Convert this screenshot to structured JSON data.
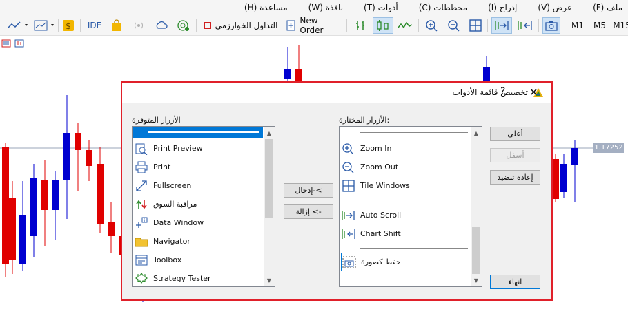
{
  "menu": {
    "items": [
      "ملف (F)",
      "عرض (V)",
      "إدراج (I)",
      "مخططات (C)",
      "أدوات (T)",
      "نافذة (W)",
      "مساعدة (H)"
    ]
  },
  "toolbar": {
    "ide_label": "IDE",
    "algo_trading_label": "التداول الخوارزمي",
    "new_order_label": "New Order",
    "timeframes": [
      "M1",
      "M5",
      "M15"
    ]
  },
  "chart": {
    "price_label": "1.17252",
    "colors": {
      "bull": "#0000d0",
      "bear": "#e00000",
      "price_line": "#9aa5b8"
    }
  },
  "dialog": {
    "title": "تخصيص قائمة الأدوات",
    "help": "?",
    "close": "✕",
    "available_label": "الأزرار المتوفرة",
    "selected_label": "الأزرار المختارة:",
    "available_items": [
      {
        "label": "",
        "icon": "separator"
      },
      {
        "label": "Print Preview",
        "icon": "print-preview-icon"
      },
      {
        "label": "Print",
        "icon": "printer-icon"
      },
      {
        "label": "Fullscreen",
        "icon": "fullscreen-icon"
      },
      {
        "label": "مراقبة السوق",
        "icon": "market-watch-icon"
      },
      {
        "label": "Data Window",
        "icon": "data-window-icon"
      },
      {
        "label": "Navigator",
        "icon": "navigator-folder-icon"
      },
      {
        "label": "Toolbox",
        "icon": "toolbox-icon"
      },
      {
        "label": "Strategy Tester",
        "icon": "strategy-tester-icon"
      }
    ],
    "selected_items": [
      {
        "label": "",
        "icon": "separator"
      },
      {
        "label": "Zoom In",
        "icon": "zoom-in-icon"
      },
      {
        "label": "Zoom Out",
        "icon": "zoom-out-icon"
      },
      {
        "label": "Tile Windows",
        "icon": "tile-windows-icon"
      },
      {
        "label": "",
        "icon": "separator"
      },
      {
        "label": "Auto Scroll",
        "icon": "auto-scroll-icon"
      },
      {
        "label": "Chart Shift",
        "icon": "chart-shift-icon"
      },
      {
        "label": "",
        "icon": "separator"
      },
      {
        "label": "حفظ كصورة",
        "icon": "screenshot-icon"
      }
    ],
    "insert_button": "إدخال-<",
    "remove_button": "إزالة <-",
    "up_button": "أعلى",
    "down_button": "أسفل",
    "reset_button": "إعادة تنضيد",
    "finish_button": "انهاء"
  }
}
